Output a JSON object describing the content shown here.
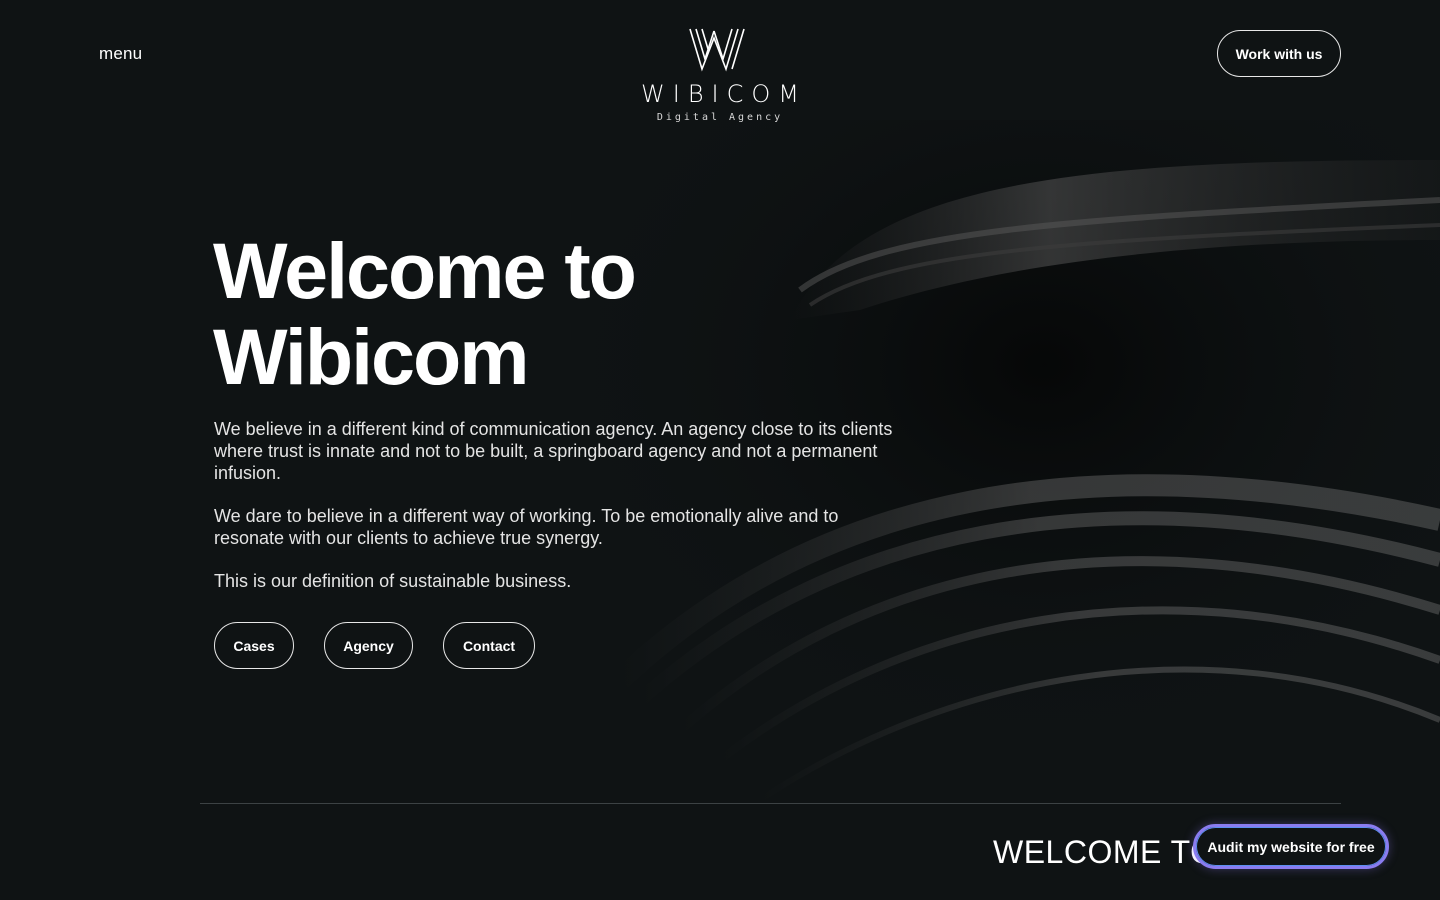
{
  "header": {
    "menu_label": "menu",
    "logo_word": "WIBICOM",
    "logo_tagline": "Digital Agency",
    "cta_label": "Work with us"
  },
  "hero": {
    "title_line1": "Welcome to",
    "title_line2": "Wibicom",
    "paragraphs": [
      "We believe in a different kind of communication agency. An agency close to its clients where trust is innate and not to be built, a springboard agency and not a permanent infusion.",
      "We dare to believe in a different way of working. To be emotionally alive and to resonate with our clients to achieve true synergy.",
      "This is our definition of sustainable business."
    ],
    "buttons": [
      "Cases",
      "Agency",
      "Contact"
    ]
  },
  "footer": {
    "marquee_text": "WELCOME TO",
    "audit_label": "Audit my website for free"
  },
  "colors": {
    "background": "#0f1314",
    "text": "#ffffff",
    "audit_border_start": "#5b8ff0",
    "audit_border_end": "#a46ef0"
  }
}
